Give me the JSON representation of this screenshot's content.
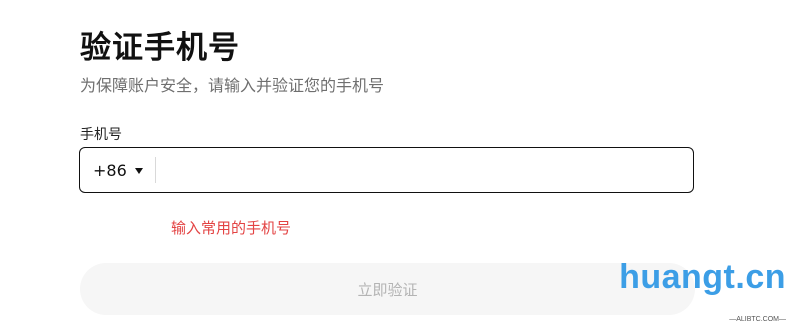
{
  "header": {
    "title": "验证手机号",
    "subtitle": "为保障账户安全，请输入并验证您的手机号"
  },
  "phone_field": {
    "label": "手机号",
    "country_code": "+86",
    "value": "",
    "error": "输入常用的手机号"
  },
  "actions": {
    "verify_label": "立即验证"
  },
  "watermark": {
    "text": "huangt.cn",
    "subtext": "—ALIBTC.COM—",
    "color": "#3c9ee6"
  },
  "colors": {
    "error": "#e34343",
    "disabled_button_bg": "#f6f6f6",
    "disabled_button_text": "#b4b4b4"
  }
}
